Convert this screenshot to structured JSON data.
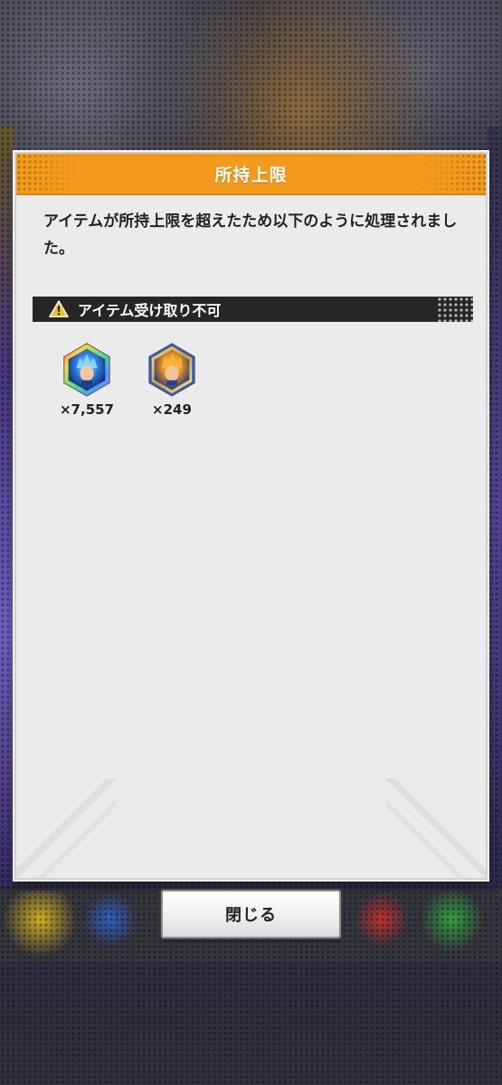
{
  "dialog": {
    "title": "所持上限",
    "message": "アイテムが所持上限を超えたため以下のように処理されました。",
    "section": {
      "label": "アイテム受け取り不可",
      "icon": "warning-icon"
    },
    "items": [
      {
        "quantity": "×7,557",
        "icon": "blue-hair-character-medal-icon",
        "color": "#2d7be0"
      },
      {
        "quantity": "×249",
        "icon": "orange-hair-character-medal-icon",
        "color": "#e08a20"
      }
    ]
  },
  "buttons": {
    "close_label": "閉じる"
  },
  "colors": {
    "header": "#f29a1c",
    "panel": "#ebebeb",
    "section_bar": "#262626"
  }
}
